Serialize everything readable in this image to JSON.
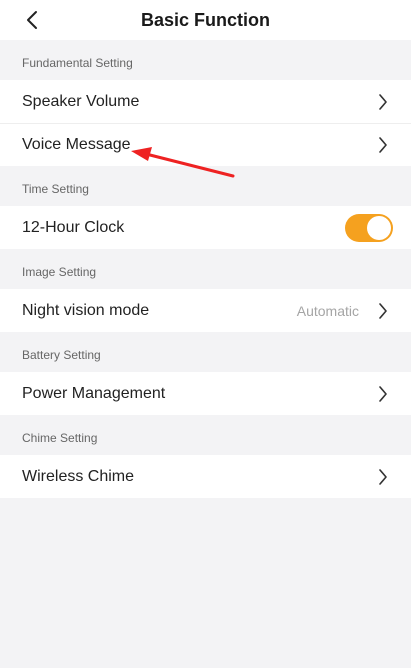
{
  "header": {
    "title": "Basic Function"
  },
  "sections": [
    {
      "label": "Fundamental Setting",
      "rows": [
        {
          "label": "Speaker Volume"
        },
        {
          "label": "Voice Message"
        }
      ]
    },
    {
      "label": "Time Setting",
      "rows": [
        {
          "label": "12-Hour Clock",
          "toggle_on": true
        }
      ]
    },
    {
      "label": "Image Setting",
      "rows": [
        {
          "label": "Night vision mode",
          "value": "Automatic"
        }
      ]
    },
    {
      "label": "Battery Setting",
      "rows": [
        {
          "label": "Power Management"
        }
      ]
    },
    {
      "label": "Chime Setting",
      "rows": [
        {
          "label": "Wireless Chime"
        }
      ]
    }
  ],
  "colors": {
    "accent": "#f5a11f",
    "annotation_arrow": "#ee2222"
  }
}
